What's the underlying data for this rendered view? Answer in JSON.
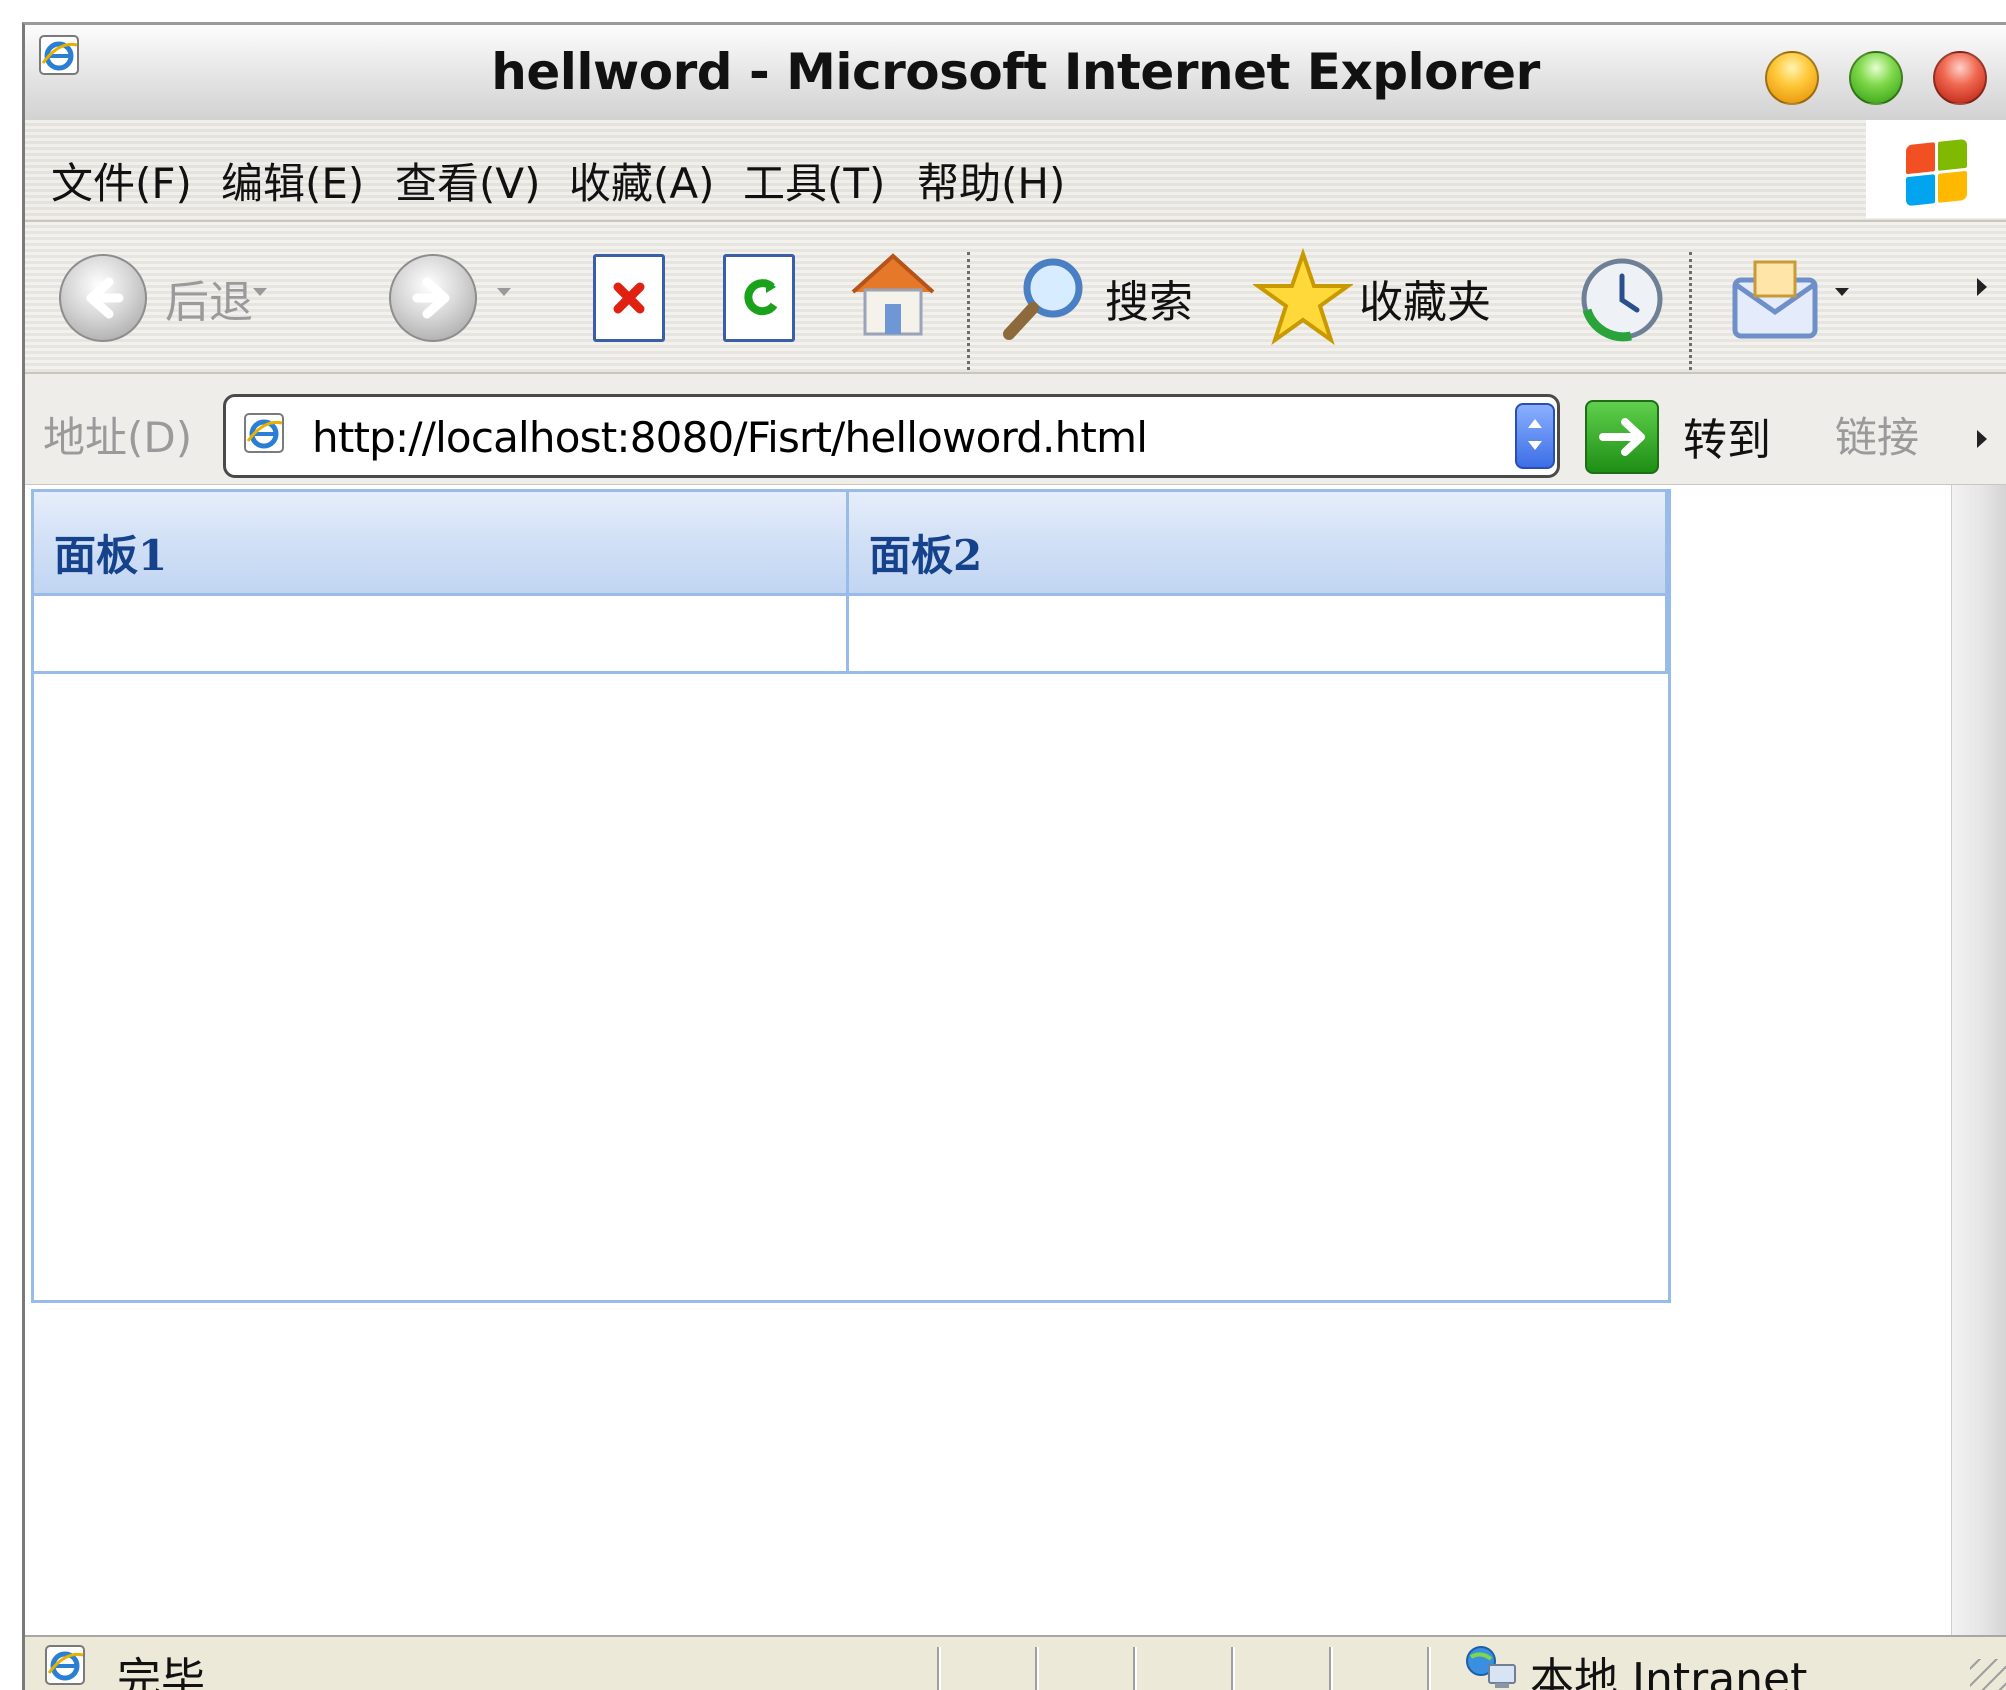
{
  "window": {
    "title": "hellword - Microsoft Internet Explorer"
  },
  "menu": {
    "items": [
      "文件(F)",
      "编辑(E)",
      "查看(V)",
      "收藏(A)",
      "工具(T)",
      "帮助(H)"
    ]
  },
  "toolbar": {
    "back_label": "后退",
    "search_label": "搜索",
    "favorites_label": "收藏夹"
  },
  "address": {
    "label": "地址(D)",
    "url": "http://localhost:8080/Fisrt/helloword.html",
    "go_label": "转到",
    "links_label": "链接"
  },
  "tabs": [
    {
      "label": "面板1"
    },
    {
      "label": "面板2"
    }
  ],
  "status": {
    "text": "完毕",
    "zone": "本地 Intranet"
  },
  "colors": {
    "tab_border": "#99bbe8",
    "tab_text": "#15428b"
  }
}
